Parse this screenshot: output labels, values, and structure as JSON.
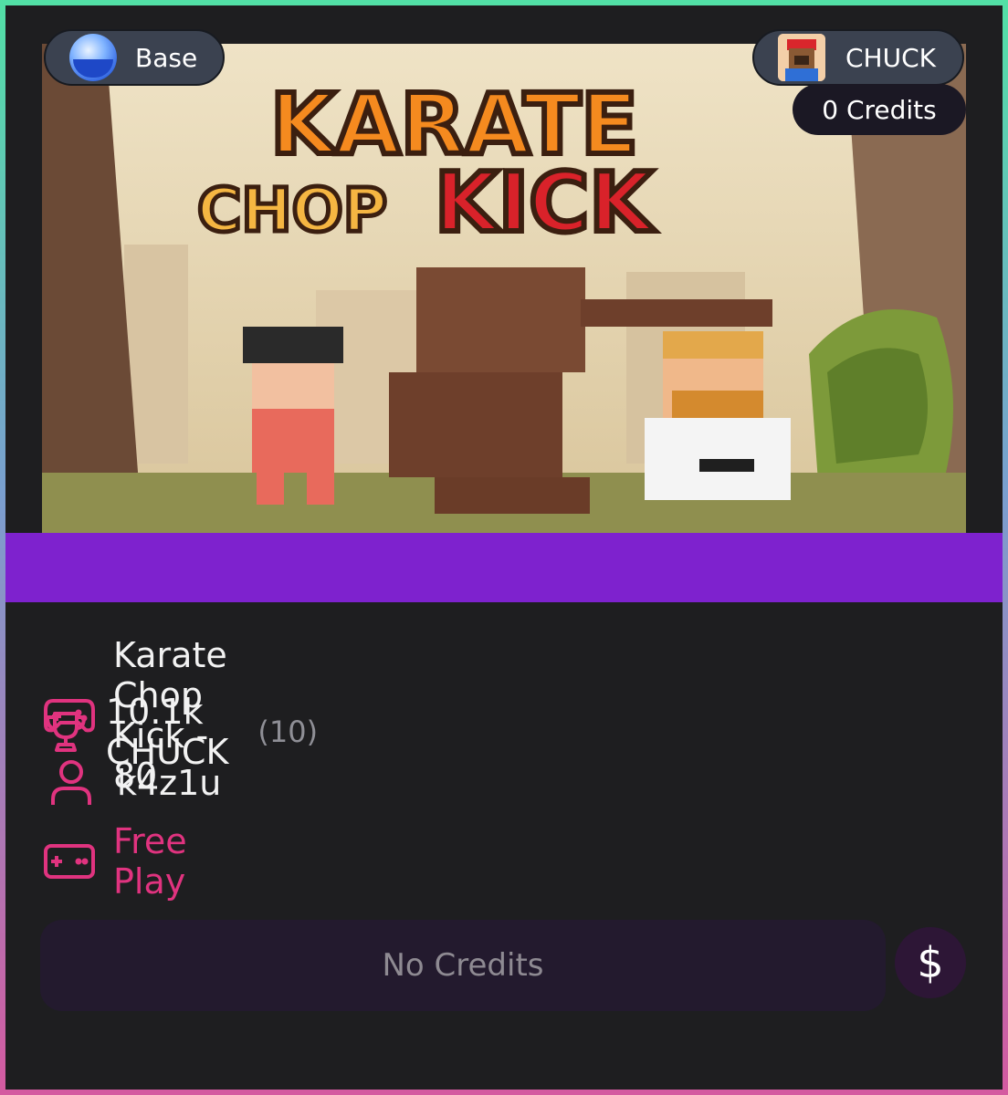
{
  "chain": {
    "label": "Base",
    "icon": "base-chain-icon"
  },
  "token": {
    "label": "CHUCK",
    "icon": "chuck-token-avatar"
  },
  "credits": {
    "label": "0 Credits"
  },
  "game": {
    "title": "Karate Chop Kick - 80",
    "prize": "10.1k CHUCK",
    "prize_count": "(10)",
    "player": "k4z1u",
    "mode": "Free Play",
    "art_title_top": "KARATE",
    "art_title_bottom_left": "CHOP",
    "art_title_bottom_right": "KICK"
  },
  "actions": {
    "primary_label": "No Credits",
    "buy_label": "$"
  },
  "colors": {
    "accent": "#e0337f",
    "band": "#7e22ce",
    "card_bg": "#1e1e20"
  }
}
